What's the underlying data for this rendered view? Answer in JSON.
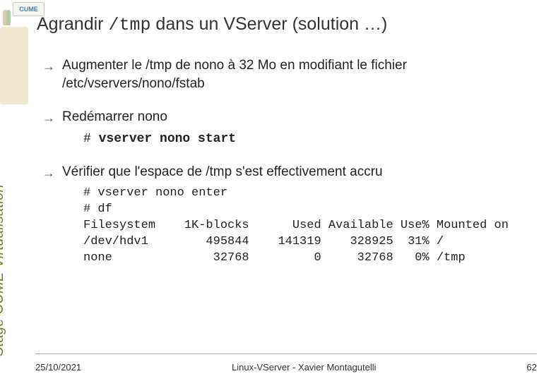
{
  "logo_text": "CUME",
  "title_parts": {
    "pre": "Agrandir ",
    "mono": "/tmp",
    "post": " dans un VServer (solution …)"
  },
  "bullets": {
    "b1": "Augmenter le /tmp de nono à 32 Mo en modifiant le fichier /etc/vservers/nono/fstab",
    "b2": "Redémarrer nono",
    "b2_cmd_prompt": "# ",
    "b2_cmd_bold": "vserver nono start",
    "b3": "Vérifier que l'espace de /tmp s'est effectivement accru",
    "b3_line1_prompt": "# ",
    "b3_line1_bold": "vserver nono enter",
    "b3_line2_prompt": "# ",
    "b3_line2_bold": "df",
    "b3_df_header": "Filesystem    1K-blocks      Used Available Use% Mounted on",
    "b3_df_row1": "/dev/hdv1        495844    141319    328925  31% /",
    "b3_df_row2": "none              32768         0     32768   0% /tmp"
  },
  "sidebar": "Stage CUME Virtualisation",
  "footer": {
    "date": "25/10/2021",
    "center": "Linux-VServer - Xavier Montagutelli",
    "page": "62"
  }
}
